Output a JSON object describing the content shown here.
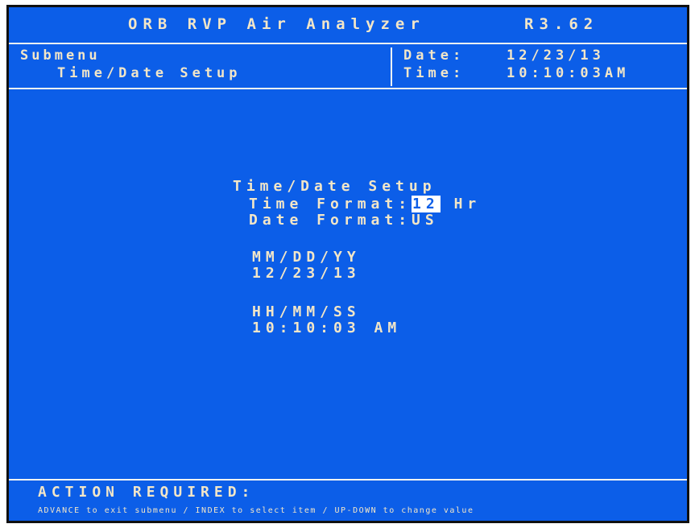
{
  "header": {
    "app_title": "ORB RVP Air Analyzer",
    "version": "R3.62"
  },
  "subheader": {
    "label": "Submenu",
    "title": "Time/Date Setup",
    "date_label": "Date:",
    "date_value": "12/23/13",
    "time_label": "Time:",
    "time_value": "10:10:03AM"
  },
  "setup": {
    "heading": "Time/Date Setup",
    "time_format_label": "Time Format:",
    "time_format_value": "12",
    "time_format_unit": "Hr",
    "date_format_label": "Date Format:",
    "date_format_value": "US",
    "date_header": "MM/DD/YY",
    "date_value": "12/23/13",
    "time_header": "HH/MM/SS",
    "time_value": "10:10:03",
    "ampm": "AM"
  },
  "footer": {
    "title": "ACTION REQUIRED:",
    "help": "ADVANCE to exit submenu / INDEX to select item / UP-DOWN to change value"
  },
  "colors": {
    "background": "#0c5ee8",
    "text": "#f2e6c8",
    "border": "#f4f4f4",
    "highlight": "#ffffff"
  }
}
